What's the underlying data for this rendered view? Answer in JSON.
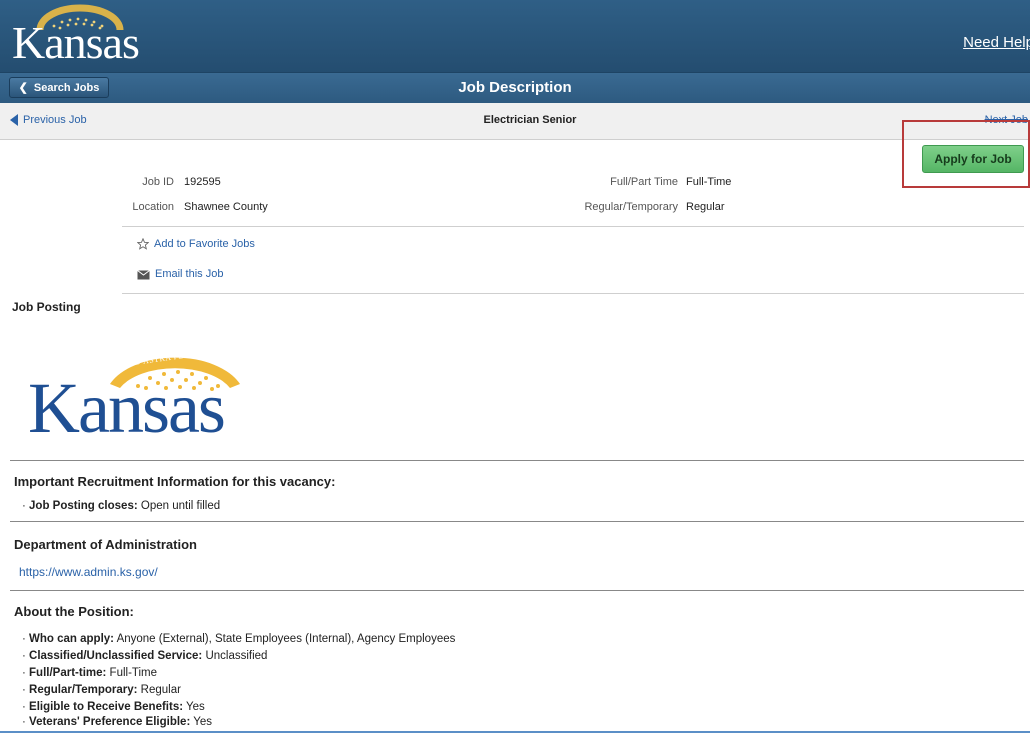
{
  "header": {
    "logo_text": "Kansas",
    "need_help": "Need Help"
  },
  "titlebar": {
    "back_label": "Search Jobs",
    "title": "Job Description"
  },
  "nav": {
    "prev_label": "Previous Job",
    "job_title": "Electrician Senior",
    "next_label": "Next Job"
  },
  "actions": {
    "apply_label": "Apply for Job",
    "favorite_label": "Add to Favorite Jobs",
    "email_label": "Email this Job"
  },
  "details": {
    "job_id_label": "Job ID",
    "job_id_value": "192595",
    "location_label": "Location",
    "location_value": "Shawnee County",
    "fulltime_label": "Full/Part Time",
    "fulltime_value": "Full-Time",
    "regular_label": "Regular/Temporary",
    "regular_value": "Regular"
  },
  "posting": {
    "heading": "Job Posting",
    "logo_text": "Kansas",
    "logo_motto": "AD ASTRA PER ASPERA",
    "recruit_heading": "Important Recruitment Information for this vacancy:",
    "recruit_items": [
      {
        "label": "Job Posting closes:",
        "value": "Open until filled"
      }
    ],
    "dept_heading": "Department of Administration",
    "dept_url": "https://www.admin.ks.gov/",
    "about_heading": "About the Position:",
    "about_items": [
      {
        "label": "Who can apply:",
        "value": "Anyone (External), State Employees (Internal), Agency Employees"
      },
      {
        "label": "Classified/Unclassified Service:",
        "value": "Unclassified"
      },
      {
        "label": "Full/Part-time:",
        "value": "Full-Time"
      },
      {
        "label": "Regular/Temporary:",
        "value": "Regular"
      },
      {
        "label": "Eligible to Receive Benefits:",
        "value": "Yes"
      },
      {
        "label": "Veterans' Preference Eligible:",
        "value": "Yes"
      }
    ]
  },
  "colors": {
    "header_blue": "#2f5f86",
    "link_blue": "#2a62a8",
    "apply_green": "#55b565",
    "highlight_red": "#b83a3a"
  }
}
